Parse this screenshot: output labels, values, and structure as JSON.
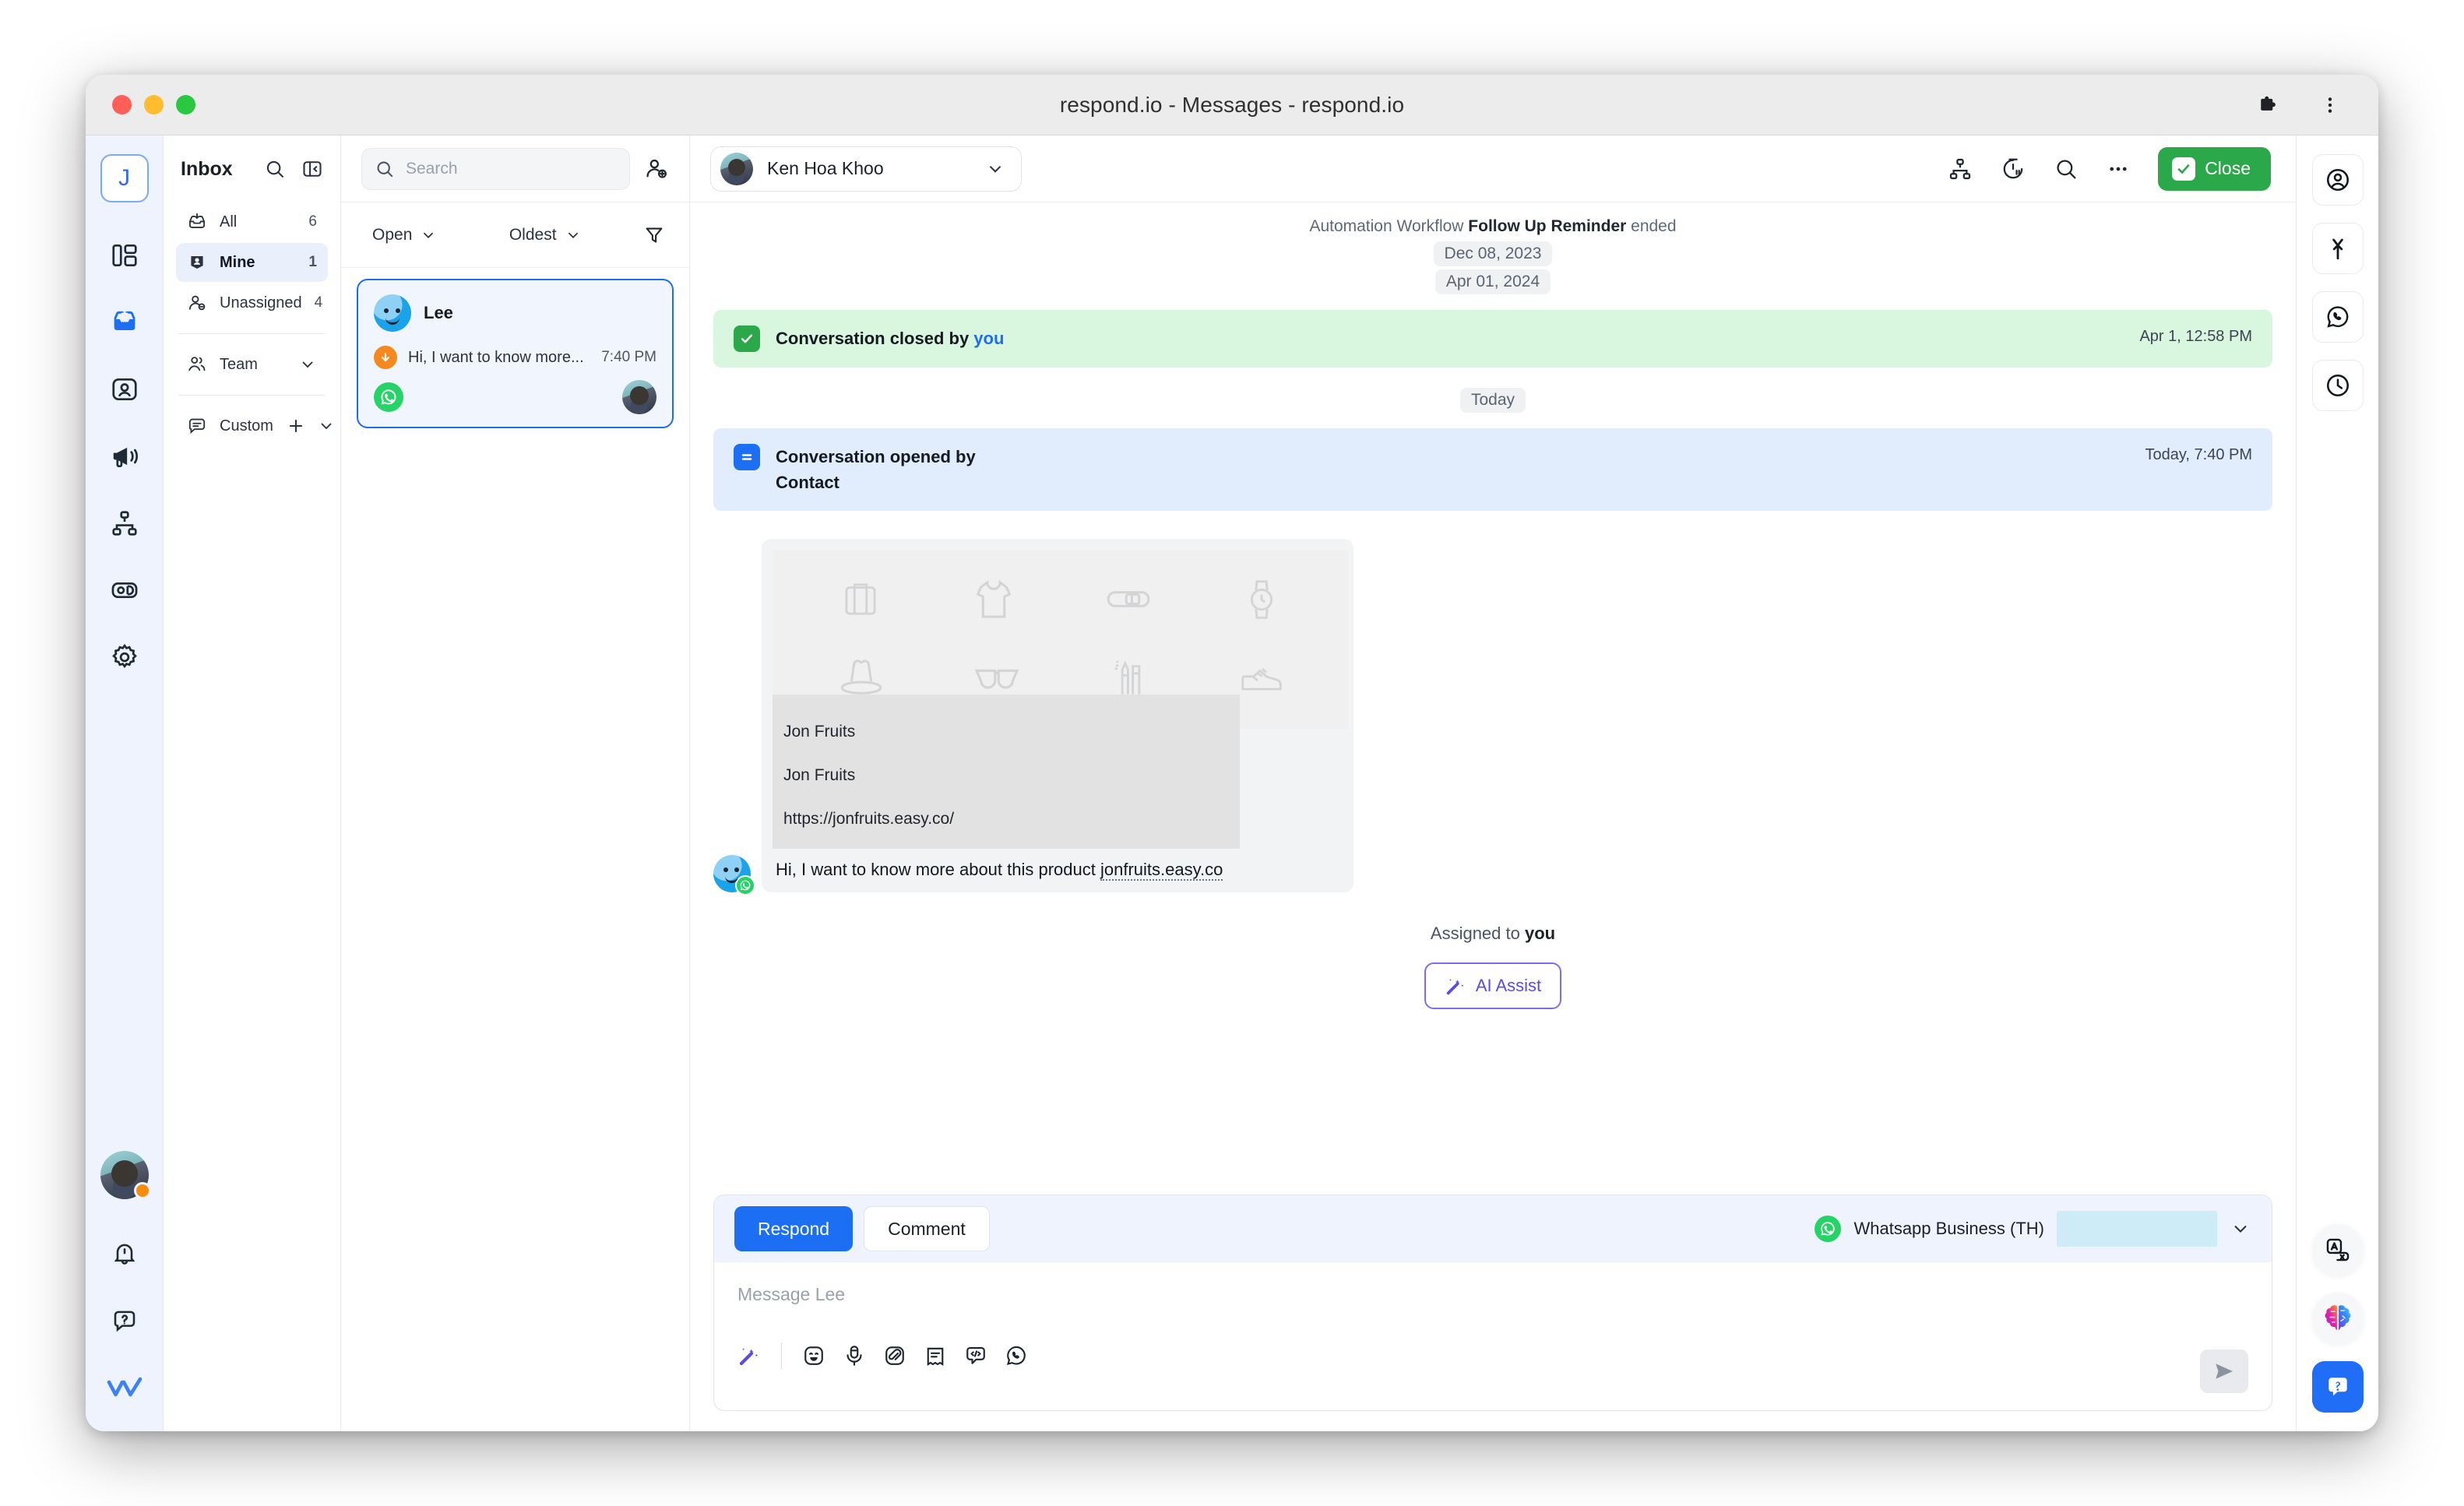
{
  "window": {
    "title": "respond.io - Messages - respond.io",
    "controls": [
      "close",
      "minimize",
      "maximize"
    ],
    "extensions_icon": "puzzle-piece-icon",
    "menu_icon": "kebab-menu-icon"
  },
  "left_rail": {
    "workspace_initial": "J",
    "items": [
      {
        "name": "dashboard",
        "icon": "layout-panels-icon",
        "active": false
      },
      {
        "name": "inbox",
        "icon": "inbox-tray-icon",
        "active": true
      },
      {
        "name": "contacts",
        "icon": "contact-card-icon",
        "active": false
      },
      {
        "name": "broadcasts",
        "icon": "megaphone-icon",
        "active": false
      },
      {
        "name": "workflows",
        "icon": "org-chart-icon",
        "active": false
      },
      {
        "name": "reports",
        "icon": "bar-chart-icon",
        "active": false
      },
      {
        "name": "settings",
        "icon": "gear-icon",
        "active": false
      }
    ],
    "bottom": [
      {
        "name": "user-avatar",
        "icon": "avatar-icon",
        "status": "away"
      },
      {
        "name": "notifications",
        "icon": "bell-icon"
      },
      {
        "name": "help",
        "icon": "question-bubble-icon"
      },
      {
        "name": "respondio-logo",
        "icon": "double-check-logo-icon"
      }
    ]
  },
  "sidebar": {
    "title": "Inbox",
    "header_icons": [
      "search-icon",
      "collapse-panel-icon"
    ],
    "items": [
      {
        "label": "All",
        "count": "6",
        "icon": "inbox-all-icon",
        "active": false
      },
      {
        "label": "Mine",
        "count": "1",
        "icon": "person-tag-icon",
        "active": true
      },
      {
        "label": "Unassigned",
        "count": "4",
        "icon": "person-minus-icon",
        "active": false
      }
    ],
    "groups": [
      {
        "label": "Team",
        "icon": "people-icon",
        "chevron": "chevron-down-icon",
        "has_add": false
      },
      {
        "label": "Custom",
        "icon": "chat-lines-icon",
        "chevron": "chevron-down-icon",
        "has_add": true,
        "add_icon": "plus-icon"
      }
    ]
  },
  "conversation_list": {
    "search": {
      "placeholder": "Search",
      "value": "",
      "icon": "search-icon"
    },
    "add_contact_icon": "person-plus-icon",
    "filters": {
      "status": {
        "label": "Open",
        "chevron": "chevron-down-icon"
      },
      "sort": {
        "label": "Oldest",
        "chevron": "chevron-down-icon"
      },
      "filter_icon": "funnel-icon"
    },
    "items": [
      {
        "name": "Lee",
        "snippet": "Hi, I want to know more...",
        "time": "7:40 PM",
        "channel_icon": "whatsapp-icon",
        "direction_icon": "arrow-down-icon",
        "selected": true
      }
    ]
  },
  "main": {
    "contact": {
      "name": "Ken Hoa Khoo",
      "chevron": "chevron-down-icon"
    },
    "header_icons": [
      "org-chart-icon",
      "snooze-timer-icon",
      "search-icon",
      "more-horizontal-icon"
    ],
    "close_button": {
      "label": "Close",
      "icon": "check-square-icon",
      "color": "#2ba84a"
    },
    "thread": {
      "automation_notice": {
        "prefix": "Automation Workflow ",
        "workflow_name": "Follow Up Reminder",
        "suffix": " ended"
      },
      "date_chips": [
        "Dec 08, 2023",
        "Apr 01, 2024"
      ],
      "events": [
        {
          "type": "closed",
          "icon": "check-square-icon",
          "text_before": "Conversation closed by ",
          "actor": "you",
          "time": "Apr 1, 12:58 PM",
          "color": "#d9f7de"
        },
        {
          "type": "opened",
          "icon": "conversation-open-icon",
          "text_before": "Conversation opened by",
          "actor": "Contact",
          "time": "Today, 7:40 PM",
          "color": "#e1ecfd"
        }
      ],
      "today_chip": "Today",
      "message": {
        "sender_avatar": "contact-avatar-icon",
        "channel_icon": "whatsapp-icon",
        "link_preview": {
          "title": "Jon Fruits",
          "site": "Jon Fruits",
          "url": "https://jonfruits.easy.co/",
          "image_alt": "product-placeholder-icons"
        },
        "text": "Hi, I want to know more about this product ",
        "link_text": "jonfruits.easy.co"
      },
      "assigned_prefix": "Assigned to ",
      "assigned_actor": "you",
      "ai_assist": {
        "label": "AI Assist",
        "icon": "magic-wand-sparkle-icon"
      }
    },
    "composer": {
      "tabs": [
        {
          "label": "Respond",
          "active": true
        },
        {
          "label": "Comment",
          "active": false
        }
      ],
      "channel": {
        "icon": "whatsapp-icon",
        "label": "Whatsapp Business (TH)",
        "redacted_value": "",
        "chevron": "chevron-down-icon"
      },
      "placeholder": "Message Lee",
      "tools": [
        "magic-wand-icon",
        "emoji-icon",
        "microphone-icon",
        "attachment-icon",
        "snippet-icon",
        "variable-code-icon",
        "whatsapp-template-icon"
      ],
      "send_icon": "send-paper-plane-icon"
    }
  },
  "right_rail": {
    "top_items": [
      {
        "name": "contact-details",
        "icon": "avatar-circle-icon"
      },
      {
        "name": "merge-contacts",
        "icon": "merge-arrow-icon"
      },
      {
        "name": "whatsapp-channel",
        "icon": "whatsapp-icon"
      },
      {
        "name": "activity-history",
        "icon": "clock-icon"
      }
    ],
    "bottom_items": [
      {
        "name": "translate",
        "icon": "translate-icon"
      },
      {
        "name": "ai-agent",
        "icon": "brain-icon"
      },
      {
        "name": "help-center",
        "icon": "question-bubble-icon"
      }
    ]
  },
  "colors": {
    "accent": "#1c6ef2",
    "success": "#2ba84a",
    "whatsapp": "#25d366",
    "ai": "#5b4ce0",
    "rail_bg": "#eef3fe",
    "selected_bg": "#f1f6fe"
  }
}
